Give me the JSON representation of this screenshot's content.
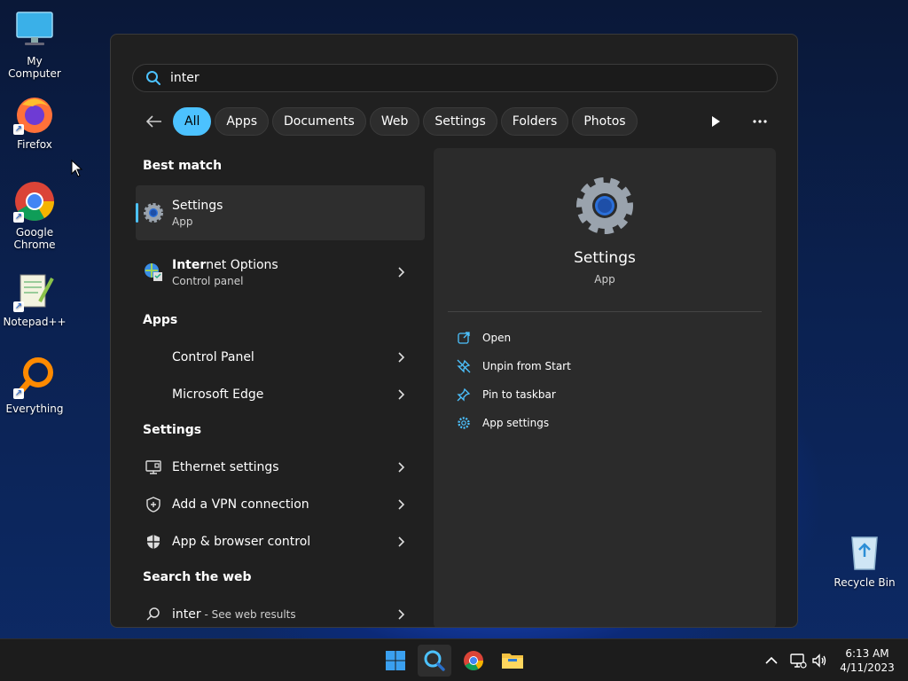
{
  "desktop": {
    "icons": [
      {
        "label": "My Computer"
      },
      {
        "label": "Firefox"
      },
      {
        "label": "Google Chrome"
      },
      {
        "label": "Notepad++"
      },
      {
        "label": "Everything"
      },
      {
        "label": "Recycle Bin"
      }
    ]
  },
  "search": {
    "value": "inter"
  },
  "filters": {
    "chips": [
      "All",
      "Apps",
      "Documents",
      "Web",
      "Settings",
      "Folders",
      "Photos"
    ],
    "active": "All"
  },
  "results": {
    "best_match_title": "Best match",
    "best_match": {
      "name": "Settings",
      "type": "App"
    },
    "internet_options": {
      "name_bold": "Inter",
      "name_rest": "net Options",
      "type": "Control panel"
    },
    "apps_title": "Apps",
    "apps": [
      "Control Panel",
      "Microsoft Edge"
    ],
    "settings_title": "Settings",
    "settings": [
      "Ethernet settings",
      "Add a VPN connection",
      "App & browser control"
    ],
    "web_title": "Search the web",
    "web_query": "inter",
    "web_suffix": " - See web results"
  },
  "detail": {
    "title": "Settings",
    "subtitle": "App",
    "actions": [
      "Open",
      "Unpin from Start",
      "Pin to taskbar",
      "App settings"
    ]
  },
  "taskbar": {
    "time": "6:13 AM",
    "date": "4/11/2023"
  },
  "colors": {
    "accent": "#4cc2ff",
    "panel_bg": "#202020",
    "pane_bg": "#2b2b2b"
  }
}
